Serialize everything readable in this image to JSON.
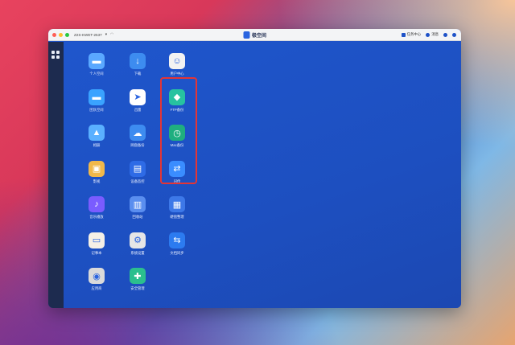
{
  "titlebar": {
    "device_name": "Z2S-KWET-2537",
    "device_caret": "▾",
    "wifi_icon": "wifi-icon",
    "brand": "极空间",
    "task_center": "任务中心",
    "notifications": "消息"
  },
  "desktop_apps": [
    {
      "label": "个人空间",
      "icon": "folder-icon"
    },
    {
      "label": "下载",
      "icon": "download-icon"
    },
    {
      "label": "用户中心",
      "icon": "user-icon"
    },
    {
      "label": "团队空间",
      "icon": "team-folder-icon"
    },
    {
      "label": "迅雷",
      "icon": "thunder-icon"
    },
    {
      "label": "FTP备份",
      "icon": "ftp-icon"
    },
    {
      "label": "相册",
      "icon": "photos-icon"
    },
    {
      "label": "网盘备份",
      "icon": "cloud-upload-icon"
    },
    {
      "label": "Mac备份",
      "icon": "time-machine-icon"
    },
    {
      "label": "影视",
      "icon": "film-icon"
    },
    {
      "label": "设备监控",
      "icon": "monitor-chart-icon"
    },
    {
      "label": "闪传",
      "icon": "flash-transfer-icon"
    },
    {
      "label": "音乐播放",
      "icon": "music-icon"
    },
    {
      "label": "回收站",
      "icon": "trash-icon"
    },
    {
      "label": "硬盘整理",
      "icon": "disk-icon"
    },
    {
      "label": "记事本",
      "icon": "notepad-icon"
    },
    {
      "label": "系统设置",
      "icon": "settings-icon"
    },
    {
      "label": "文档同步",
      "icon": "sync-icon"
    },
    {
      "label": "应用商",
      "icon": "app-store-icon"
    },
    {
      "label": "安全管理",
      "icon": "shield-icon"
    }
  ],
  "colors": {
    "accent": "#1e52c8",
    "sidebar": "#1d2b4f",
    "highlight": "#e53535"
  }
}
